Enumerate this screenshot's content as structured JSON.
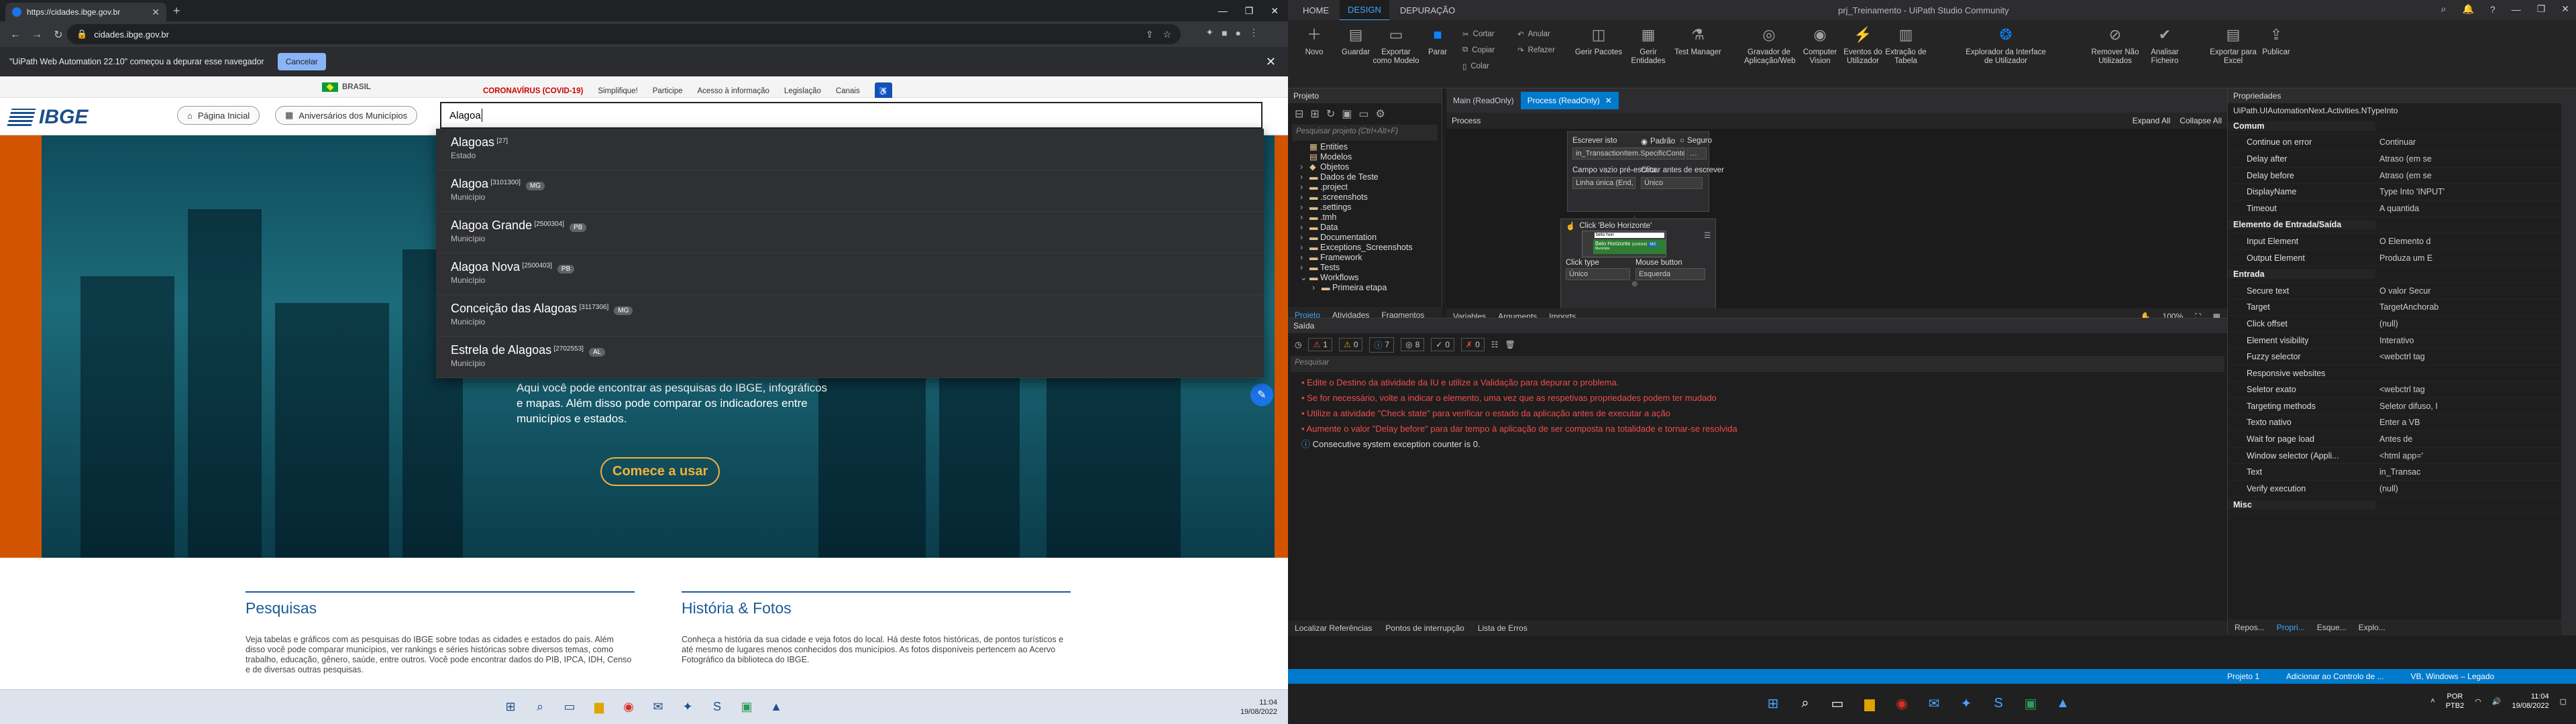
{
  "chrome": {
    "tab_title": "https://cidades.ibge.gov.br",
    "url": "cidades.ibge.gov.br",
    "debug_msg": "\"UiPath Web Automation 22.10\" começou a depurar esse navegador",
    "cancel": "Cancelar"
  },
  "gov": {
    "brasil": "BRASIL",
    "links": [
      "CORONAVÍRUS (COVID-19)",
      "Simplifique!",
      "Participe",
      "Acesso à informação",
      "Legislação",
      "Canais"
    ]
  },
  "ibge": {
    "logo": "IBGE",
    "btn_home": "Página Inicial",
    "btn_anniv": "Aniversários dos Municípios",
    "search_value": "Alagoa",
    "results": [
      {
        "name": "Alagoas",
        "code": "[27]",
        "uf": "",
        "type": "Estado"
      },
      {
        "name": "Alagoa",
        "code": "[3101300]",
        "uf": "MG",
        "type": "Município"
      },
      {
        "name": "Alagoa Grande",
        "code": "[2500304]",
        "uf": "PB",
        "type": "Município"
      },
      {
        "name": "Alagoa Nova",
        "code": "[2500403]",
        "uf": "PB",
        "type": "Município"
      },
      {
        "name": "Conceição das Alagoas",
        "code": "[3117306]",
        "uf": "MG",
        "type": "Município"
      },
      {
        "name": "Estrela de Alagoas",
        "code": "[2702553]",
        "uf": "AL",
        "type": "Município"
      }
    ],
    "hero_text": "Aqui você pode encontrar as pesquisas do IBGE, infográficos e mapas. Além disso pode comparar os indicadores entre municípios e estados.",
    "cta": "Comece a usar",
    "sec1_title": "Pesquisas",
    "sec1_text": "Veja tabelas e gráficos com as pesquisas do IBGE sobre todas as cidades e estados do país. Além disso você pode comparar municípios, ver rankings e séries históricas sobre diversos temas, como trabalho, educação, gênero, saúde, entre outros. Você pode encontrar dados do PIB, IPCA, IDH, Censo e de diversas outras pesquisas.",
    "sec2_title": "História & Fotos",
    "sec2_text": "Conheça a história da sua cidade e veja fotos do local. Há deste fotos históricas, de pontos turísticos e até mesmo de lugares menos conhecidos dos municípios. As fotos disponíveis pertencem ao Acervo Fotográfico da biblioteca do IBGE."
  },
  "tray1": {
    "time": "11:04",
    "date": "19/08/2022"
  },
  "uipath": {
    "menu": [
      "HOME",
      "DESIGN",
      "DEPURAÇÃO"
    ],
    "title": "prj_Treinamento - UiPath Studio Community",
    "ribbon": {
      "novo": "Novo",
      "guardar": "Guardar",
      "exportar": "Exportar como Modelo",
      "parar": "Parar",
      "cortar": "Cortar",
      "copiar": "Copiar",
      "colar": "Colar",
      "anular": "Anular",
      "refazer": "Refazer",
      "pacotes": "Gerir Pacotes",
      "entidades": "Gerir Entidades",
      "test": "Test Manager",
      "gravador": "Gravador de Aplicação/Web",
      "vision": "Computer Vision",
      "eventos": "Eventos do Utilizador",
      "extracao": "Extração de Tabela",
      "explorador": "Explorador da Interface de Utilizador",
      "remover": "Remover Não Utilizados",
      "analisar": "Analisar Ficheiro",
      "excel": "Exportar para Excel",
      "publicar": "Publicar"
    },
    "project": {
      "title": "Projeto",
      "search": "Pesquisar projeto (Ctrl+Alt+F)",
      "items": [
        "Entities",
        "Modelos",
        "Objetos",
        "Dados de Teste",
        ".project",
        ".screenshots",
        ".settings",
        ".tmh",
        "Data",
        "Documentation",
        "Exceptions_Screenshots",
        "Framework",
        "Tests",
        "Workflows",
        "Primeira etapa"
      ],
      "tabs": [
        "Projeto",
        "Atividades",
        "Fragmentos"
      ]
    },
    "doc": {
      "tab1": "Main (ReadOnly)",
      "tab2": "Process (ReadOnly)",
      "crumb": "Process",
      "expand": "Expand All",
      "collapse": "Collapse All",
      "write": "Escrever isto",
      "padrao": "Padrão",
      "seguro": "Seguro",
      "write_value": "in_TransactionItem.SpecificContent(\"Cidade\").T",
      "empty_field": "Campo vazio pré-escrita",
      "empty_value": "Linha única (End, Shift+Home, Del)",
      "click_before": "Clicar antes de escrever",
      "click_before_value": "Único",
      "click_title": "Click 'Belo Horizonte'",
      "snap_search": "belo hori",
      "snap_result": "Belo Horizonte",
      "snap_code": "[3106200]",
      "snap_uf": "MG",
      "snap_type": "Município",
      "click_type": "Click type",
      "click_type_value": "Único",
      "mouse_btn": "Mouse button",
      "mouse_btn_value": "Esquerda",
      "bottom": [
        "Variables",
        "Arguments",
        "Imports"
      ],
      "zoom": "100%"
    },
    "output": {
      "title": "Saída",
      "counts": [
        "1",
        "0",
        "7",
        "8",
        "0",
        "0"
      ],
      "search": "Pesquisar",
      "lines": [
        "Edite o Destino da atividade da IU e utilize a Validação para depurar o problema.",
        "Se for necessário, volte a indicar o elemento, uma vez que as respetivas propriedades podem ter mudado",
        "Utilize a atividade \"Check state\" para verificar o estado da aplicação antes de executar a ação",
        "Aumente o valor \"Delay before\" para dar tempo à aplicação de ser composta na totalidade e tornar-se resolvida"
      ],
      "info": "Consecutive system exception counter is 0.",
      "footer": [
        "Localizar Referências",
        "Pontos de interrupção",
        "Lista de Erros"
      ]
    },
    "props": {
      "title": "Propriedades",
      "type": "UiPath.UIAutomationNext.Activities.NTypeInto",
      "rows": [
        {
          "k": "Comum",
          "cat": true,
          "v": ""
        },
        {
          "k": "Continue on error",
          "v": "Continuar"
        },
        {
          "k": "Delay after",
          "v": "Atraso (em se"
        },
        {
          "k": "Delay before",
          "v": "Atraso (em se"
        },
        {
          "k": "DisplayName",
          "v": "Type Into 'INPUT'"
        },
        {
          "k": "Timeout",
          "v": "A quantida"
        },
        {
          "k": "Elemento de Entrada/Saída",
          "cat": true,
          "v": ""
        },
        {
          "k": "Input Element",
          "v": "O Elemento d"
        },
        {
          "k": "Output Element",
          "v": "Produza um E"
        },
        {
          "k": "Entrada",
          "cat": true,
          "v": ""
        },
        {
          "k": "Secure text",
          "v": "O valor Secur"
        },
        {
          "k": "Target",
          "v": "TargetAnchorab"
        },
        {
          "k": "Click offset",
          "v": "(null)"
        },
        {
          "k": "Element visibility",
          "v": "Interativo"
        },
        {
          "k": "Fuzzy selector",
          "v": "<webctrl tag"
        },
        {
          "k": "Responsive websites",
          "v": ""
        },
        {
          "k": "Seletor exato",
          "v": "<webctrl tag"
        },
        {
          "k": "Targeting methods",
          "v": "Seletor difuso, I"
        },
        {
          "k": "Texto nativo",
          "v": "Enter a VB"
        },
        {
          "k": "Wait for page load",
          "v": "Antes de"
        },
        {
          "k": "Window selector (Appli...",
          "v": "<html app='"
        },
        {
          "k": "Text",
          "v": "in_Transac"
        },
        {
          "k": "Verify execution",
          "v": "(null)"
        },
        {
          "k": "Misc",
          "cat": true,
          "v": ""
        }
      ],
      "tabs": [
        "Repos...",
        "Propri...",
        "Esque...",
        "Explo..."
      ]
    },
    "status": {
      "project": "Projeto 1",
      "add": "Adicionar ao Controlo de ...",
      "lang": "VB, Windows – Legado"
    },
    "tray": {
      "lang": "POR",
      "kb": "PTB2",
      "time": "11:04",
      "date": "19/08/2022"
    }
  }
}
